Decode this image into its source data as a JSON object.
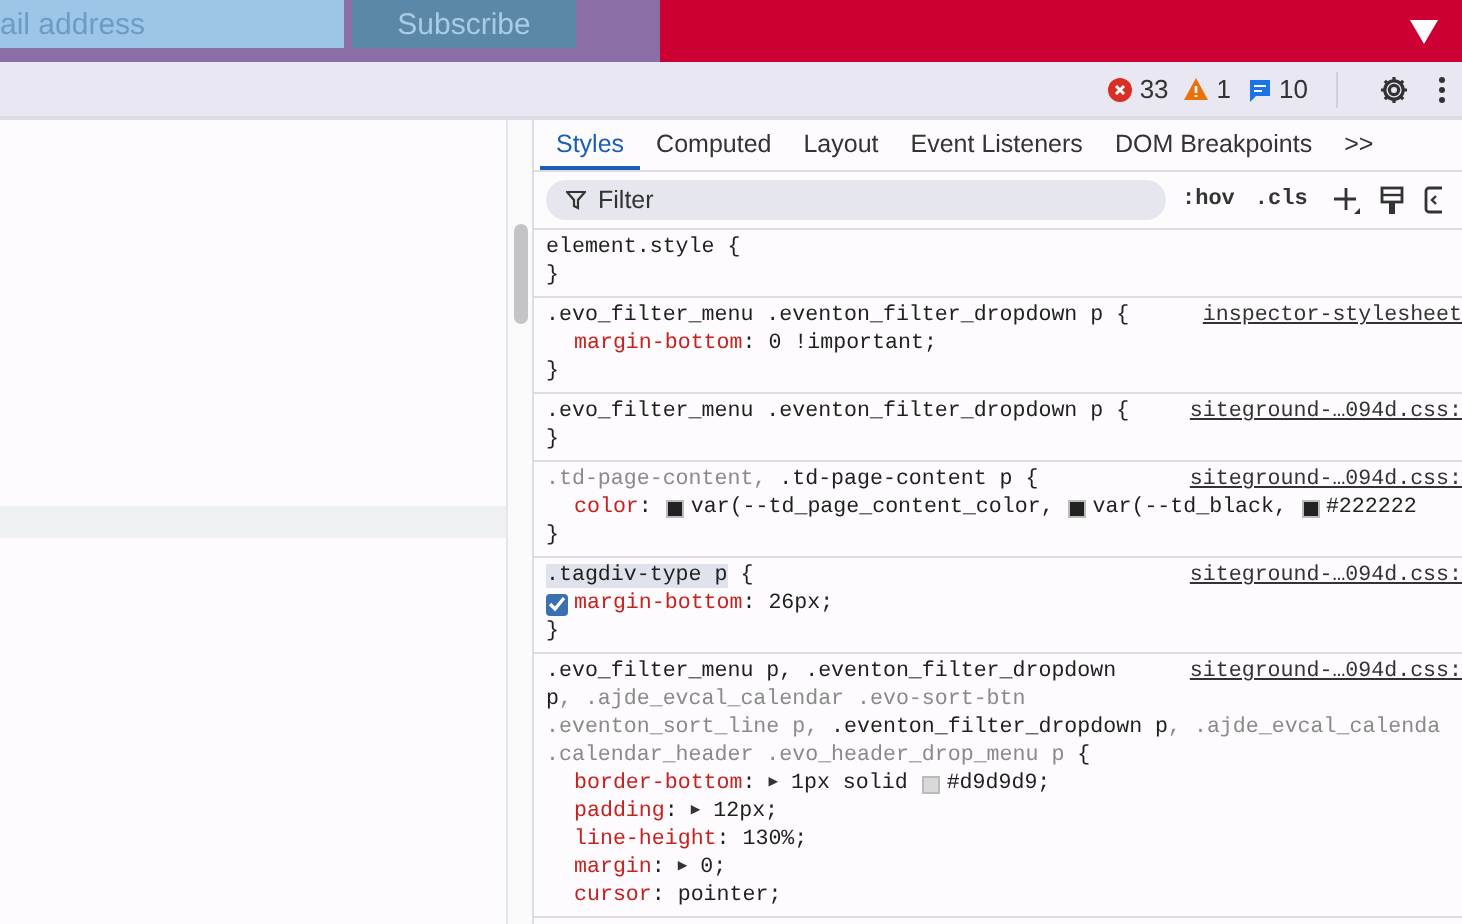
{
  "banner": {
    "email_placeholder": "ail address",
    "subscribe": "Subscribe"
  },
  "console_counts": [
    {
      "kind": "error",
      "count": "33"
    },
    {
      "kind": "warning",
      "count": "1"
    },
    {
      "kind": "info",
      "count": "10"
    }
  ],
  "tabs": [
    {
      "label": "Styles",
      "selected": true
    },
    {
      "label": "Computed",
      "selected": false
    },
    {
      "label": "Layout",
      "selected": false
    },
    {
      "label": "Event Listeners",
      "selected": false
    },
    {
      "label": "DOM Breakpoints",
      "selected": false
    }
  ],
  "tabs_overflow": ">>",
  "filter": {
    "placeholder": "Filter"
  },
  "toggles": [
    ":hov",
    ".cls"
  ],
  "rules": [
    {
      "selector_lines": [
        [
          {
            "text": "element.style {",
            "matched": true
          }
        ]
      ],
      "close": "}"
    },
    {
      "selector_lines": [
        [
          {
            "text": ".evo_filter_menu .eventon_filter_dropdown p {",
            "matched": true
          }
        ]
      ],
      "source": "inspector-stylesheet",
      "properties": [
        {
          "tokens": [
            {
              "kind": "name",
              "text": "margin-bottom"
            },
            {
              "kind": "text",
              "text": ": 0 !important;"
            }
          ]
        }
      ],
      "close": "}"
    },
    {
      "selector_lines": [
        [
          {
            "text": ".evo_filter_menu .eventon_filter_dropdown p {",
            "matched": true
          }
        ]
      ],
      "source": "siteground-…094d.css:",
      "close": "}"
    },
    {
      "selector_lines": [
        [
          {
            "text": ".td-page-content, ",
            "matched": false
          },
          {
            "text": ".td-page-content p {",
            "matched": true
          }
        ]
      ],
      "source": "siteground-…094d.css:",
      "properties": [
        {
          "tokens": [
            {
              "kind": "name",
              "text": "color"
            },
            {
              "kind": "text",
              "text": ": "
            },
            {
              "kind": "swatch",
              "color": "#222222"
            },
            {
              "kind": "text",
              "text": "var(--td_page_content_color, "
            },
            {
              "kind": "swatch",
              "color": "#222222"
            },
            {
              "kind": "text",
              "text": "var(--td_black, "
            },
            {
              "kind": "swatch",
              "color": "#222222"
            },
            {
              "kind": "text",
              "text": "#222222"
            }
          ]
        }
      ],
      "close": "}"
    },
    {
      "selector_lines": [
        [
          {
            "text": ".tagdiv-type p",
            "matched": true,
            "highlighted": true
          },
          {
            "text": " {",
            "matched": true
          }
        ]
      ],
      "source": "siteground-…094d.css:",
      "properties": [
        {
          "checked": true,
          "tokens": [
            {
              "kind": "name",
              "text": "margin-bottom"
            },
            {
              "kind": "text",
              "text": ": 26px;"
            }
          ]
        }
      ],
      "close": "}"
    },
    {
      "selector_lines": [
        [
          {
            "text": ".evo_filter_menu p, .eventon_filter_dropdown",
            "matched": true
          }
        ],
        [
          {
            "text": "p",
            "matched": true
          },
          {
            "text": ", .ajde_evcal_calendar .evo-sort-btn",
            "matched": false
          }
        ],
        [
          {
            "text": ".eventon_sort_line p, ",
            "matched": false
          },
          {
            "text": ".eventon_filter_dropdown p",
            "matched": true
          },
          {
            "text": ", .ajde_evcal_calenda",
            "matched": false
          }
        ],
        [
          {
            "text": ".calendar_header .evo_header_drop_menu p ",
            "matched": false
          },
          {
            "text": "{",
            "matched": true
          }
        ]
      ],
      "source": "siteground-…094d.css:",
      "properties": [
        {
          "tokens": [
            {
              "kind": "name",
              "text": "border-bottom"
            },
            {
              "kind": "text",
              "text": ": "
            },
            {
              "kind": "expander",
              "text": "▶"
            },
            {
              "kind": "text",
              "text": " 1px solid "
            },
            {
              "kind": "swatch",
              "color": "#d9d9d9"
            },
            {
              "kind": "text",
              "text": "#d9d9d9;"
            }
          ]
        },
        {
          "tokens": [
            {
              "kind": "name",
              "text": "padding"
            },
            {
              "kind": "text",
              "text": ": "
            },
            {
              "kind": "expander",
              "text": "▶"
            },
            {
              "kind": "text",
              "text": " 12px;"
            }
          ]
        },
        {
          "tokens": [
            {
              "kind": "name",
              "text": "line-height"
            },
            {
              "kind": "text",
              "text": ": 130%;"
            }
          ]
        },
        {
          "tokens": [
            {
              "kind": "name",
              "text": "margin"
            },
            {
              "kind": "text",
              "text": ": "
            },
            {
              "kind": "expander",
              "text": "▶"
            },
            {
              "kind": "text",
              "text": " 0;"
            }
          ]
        },
        {
          "tokens": [
            {
              "kind": "name",
              "text": "cursor"
            },
            {
              "kind": "text",
              "text": ": pointer;"
            }
          ]
        }
      ]
    }
  ]
}
